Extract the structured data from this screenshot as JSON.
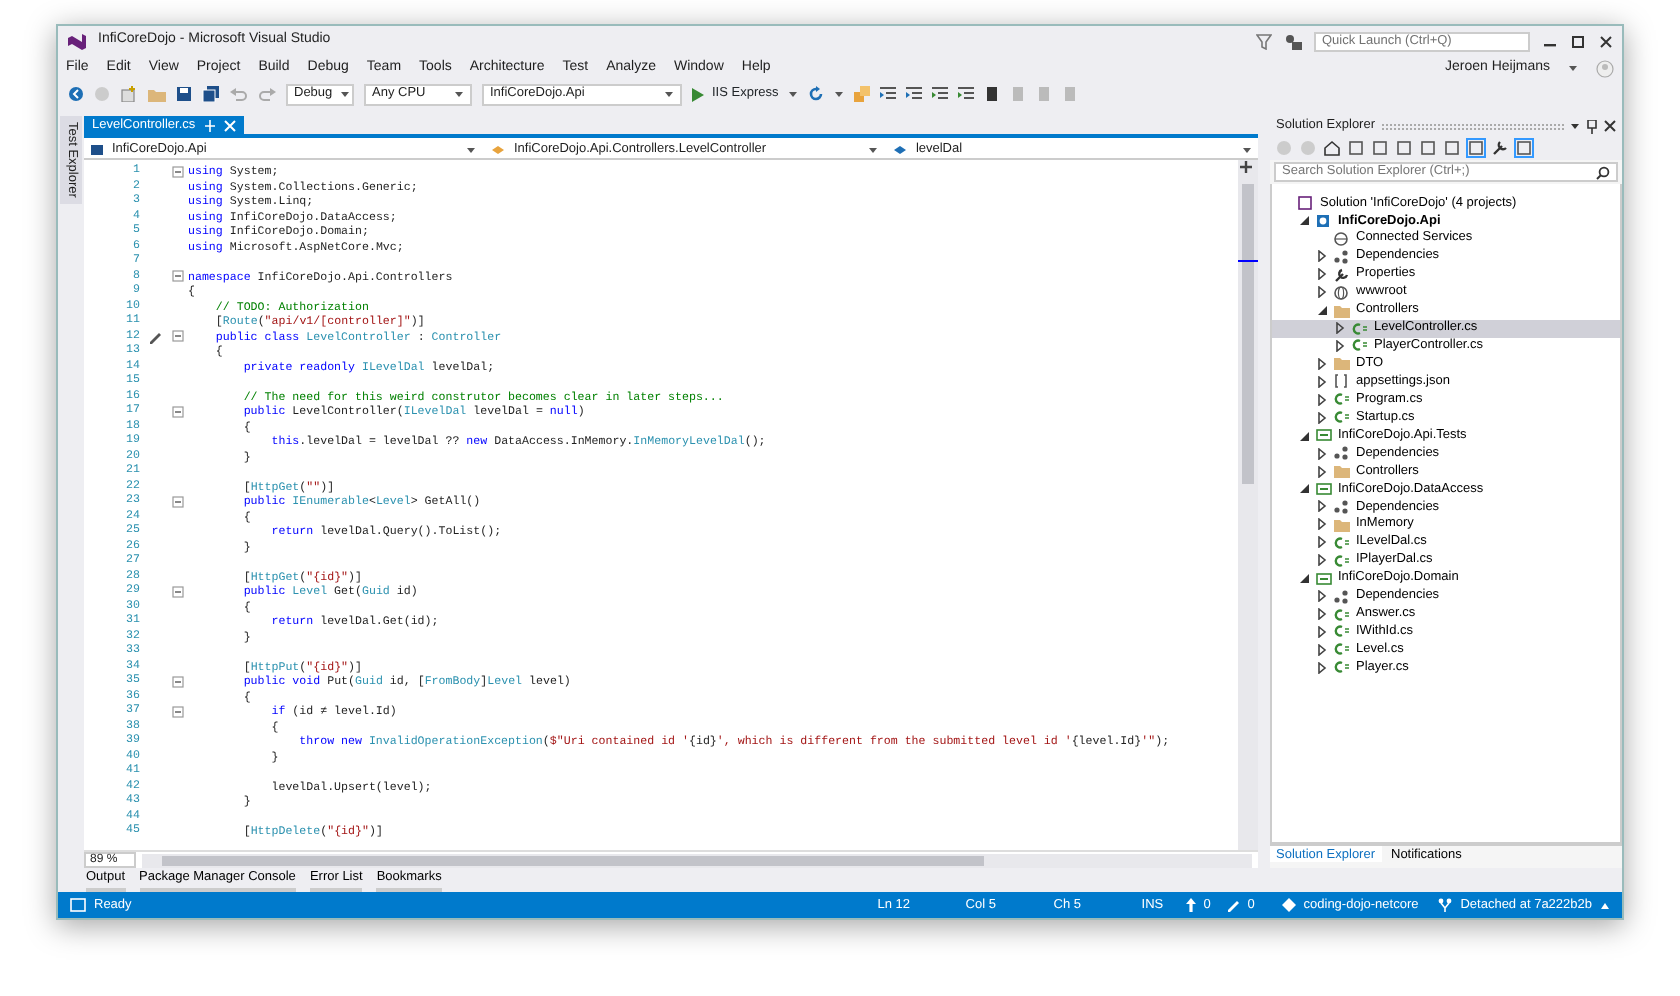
{
  "window": {
    "title": "InfiCoreDojo - Microsoft Visual Studio"
  },
  "title_bar": {
    "quick_launch": {
      "placeholder": "Quick Launch (Ctrl+Q)"
    },
    "user": "Jeroen Heijmans"
  },
  "menu": [
    "File",
    "Edit",
    "View",
    "Project",
    "Build",
    "Debug",
    "Team",
    "Tools",
    "Architecture",
    "Test",
    "Analyze",
    "Window",
    "Help"
  ],
  "toolbar": {
    "configuration": "Debug",
    "platform": "Any CPU",
    "startup_project": "InfiCoreDojo.Api",
    "run_button": "IIS Express"
  },
  "side_tabs": [
    "Test Explorer"
  ],
  "editor": {
    "tabs": [
      {
        "label": "LevelController.cs",
        "selected": true
      }
    ],
    "navigation": [
      "InfiCoreDojo.Api",
      "InfiCoreDojo.Api.Controllers.LevelController",
      "levelDal"
    ],
    "lines": [
      {
        "number": "1",
        "foldable": true,
        "edit_marker": false,
        "tokens": [
          {
            "kind": "keyword",
            "text": "using"
          },
          {
            "kind": "plain",
            "text": " System;"
          }
        ]
      },
      {
        "number": "2",
        "foldable": false,
        "edit_marker": false,
        "tokens": [
          {
            "kind": "keyword",
            "text": "using"
          },
          {
            "kind": "plain",
            "text": " System.Collections.Generic;"
          }
        ]
      },
      {
        "number": "3",
        "foldable": false,
        "edit_marker": false,
        "tokens": [
          {
            "kind": "keyword",
            "text": "using"
          },
          {
            "kind": "plain",
            "text": " System.Linq;"
          }
        ]
      },
      {
        "number": "4",
        "foldable": false,
        "edit_marker": false,
        "tokens": [
          {
            "kind": "keyword",
            "text": "using"
          },
          {
            "kind": "plain",
            "text": " InfiCoreDojo.DataAccess;"
          }
        ]
      },
      {
        "number": "5",
        "foldable": false,
        "edit_marker": false,
        "tokens": [
          {
            "kind": "keyword",
            "text": "using"
          },
          {
            "kind": "plain",
            "text": " InfiCoreDojo.Domain;"
          }
        ]
      },
      {
        "number": "6",
        "foldable": false,
        "edit_marker": false,
        "tokens": [
          {
            "kind": "keyword",
            "text": "using"
          },
          {
            "kind": "plain",
            "text": " Microsoft.AspNetCore.Mvc;"
          }
        ]
      },
      {
        "number": "7",
        "foldable": false,
        "edit_marker": false
      },
      {
        "number": "8",
        "foldable": true,
        "edit_marker": false,
        "tokens": [
          {
            "kind": "keyword",
            "text": "namespace"
          },
          {
            "kind": "plain",
            "text": " InfiCoreDojo.Api.Controllers"
          }
        ]
      },
      {
        "number": "9",
        "foldable": false,
        "edit_marker": false,
        "tokens": [
          {
            "kind": "plain",
            "text": "{"
          }
        ]
      },
      {
        "number": "10",
        "foldable": false,
        "edit_marker": false,
        "tokens": [
          {
            "kind": "comment",
            "text": "    // TODO: Authorization"
          }
        ]
      },
      {
        "number": "11",
        "foldable": false,
        "edit_marker": false,
        "tokens": [
          {
            "kind": "plain",
            "text": "    ["
          },
          {
            "kind": "type",
            "text": "Route"
          },
          {
            "kind": "plain",
            "text": "("
          },
          {
            "kind": "string",
            "text": "\"api/v1/[controller]\""
          },
          {
            "kind": "plain",
            "text": ")]"
          }
        ]
      },
      {
        "number": "12",
        "foldable": true,
        "edit_marker": true,
        "tokens": [
          {
            "kind": "keyword",
            "text": "    public class"
          },
          {
            "kind": "type",
            "text": " LevelController"
          },
          {
            "kind": "plain",
            "text": " : "
          },
          {
            "kind": "type",
            "text": "Controller"
          }
        ]
      },
      {
        "number": "13",
        "foldable": false,
        "edit_marker": false,
        "tokens": [
          {
            "kind": "plain",
            "text": "    {"
          }
        ]
      },
      {
        "number": "14",
        "foldable": false,
        "edit_marker": false,
        "tokens": [
          {
            "kind": "keyword",
            "text": "        private readonly"
          },
          {
            "kind": "type",
            "text": " ILevelDal"
          },
          {
            "kind": "plain",
            "text": " levelDal;"
          }
        ]
      },
      {
        "number": "15",
        "foldable": false,
        "edit_marker": false
      },
      {
        "number": "16",
        "foldable": false,
        "edit_marker": false,
        "tokens": [
          {
            "kind": "comment",
            "text": "        // The need for this weird construtor becomes clear in later steps..."
          }
        ]
      },
      {
        "number": "17",
        "foldable": true,
        "edit_marker": false,
        "tokens": [
          {
            "kind": "keyword",
            "text": "        public"
          },
          {
            "kind": "plain",
            "text": " LevelController("
          },
          {
            "kind": "type",
            "text": "ILevelDal"
          },
          {
            "kind": "plain",
            "text": " levelDal = "
          },
          {
            "kind": "keyword",
            "text": "null"
          },
          {
            "kind": "plain",
            "text": ")"
          }
        ]
      },
      {
        "number": "18",
        "foldable": false,
        "edit_marker": false,
        "tokens": [
          {
            "kind": "plain",
            "text": "        {"
          }
        ]
      },
      {
        "number": "19",
        "foldable": false,
        "edit_marker": false,
        "tokens": [
          {
            "kind": "keyword",
            "text": "            this"
          },
          {
            "kind": "plain",
            "text": ".levelDal = levelDal ?? "
          },
          {
            "kind": "keyword",
            "text": "new"
          },
          {
            "kind": "plain",
            "text": " DataAccess.InMemory."
          },
          {
            "kind": "type",
            "text": "InMemoryLevelDal"
          },
          {
            "kind": "plain",
            "text": "();"
          }
        ]
      },
      {
        "number": "20",
        "foldable": false,
        "edit_marker": false,
        "tokens": [
          {
            "kind": "plain",
            "text": "        }"
          }
        ]
      },
      {
        "number": "21",
        "foldable": false,
        "edit_marker": false
      },
      {
        "number": "22",
        "foldable": false,
        "edit_marker": false,
        "tokens": [
          {
            "kind": "plain",
            "text": "        ["
          },
          {
            "kind": "type",
            "text": "HttpGet"
          },
          {
            "kind": "plain",
            "text": "("
          },
          {
            "kind": "string",
            "text": "\"\""
          },
          {
            "kind": "plain",
            "text": ")]"
          }
        ]
      },
      {
        "number": "23",
        "foldable": true,
        "edit_marker": false,
        "tokens": [
          {
            "kind": "keyword",
            "text": "        public"
          },
          {
            "kind": "type",
            "text": " IEnumerable"
          },
          {
            "kind": "plain",
            "text": "<"
          },
          {
            "kind": "type",
            "text": "Level"
          },
          {
            "kind": "plain",
            "text": "> GetAll()"
          }
        ]
      },
      {
        "number": "24",
        "foldable": false,
        "edit_marker": false,
        "tokens": [
          {
            "kind": "plain",
            "text": "        {"
          }
        ]
      },
      {
        "number": "25",
        "foldable": false,
        "edit_marker": false,
        "tokens": [
          {
            "kind": "keyword",
            "text": "            return"
          },
          {
            "kind": "plain",
            "text": " levelDal.Query().ToList();"
          }
        ]
      },
      {
        "number": "26",
        "foldable": false,
        "edit_marker": false,
        "tokens": [
          {
            "kind": "plain",
            "text": "        }"
          }
        ]
      },
      {
        "number": "27",
        "foldable": false,
        "edit_marker": false
      },
      {
        "number": "28",
        "foldable": false,
        "edit_marker": false,
        "tokens": [
          {
            "kind": "plain",
            "text": "        ["
          },
          {
            "kind": "type",
            "text": "HttpGet"
          },
          {
            "kind": "plain",
            "text": "("
          },
          {
            "kind": "string",
            "text": "\"{id}\""
          },
          {
            "kind": "plain",
            "text": ")]"
          }
        ]
      },
      {
        "number": "29",
        "foldable": true,
        "edit_marker": false,
        "tokens": [
          {
            "kind": "keyword",
            "text": "        public"
          },
          {
            "kind": "type",
            "text": " Level"
          },
          {
            "kind": "plain",
            "text": " Get("
          },
          {
            "kind": "type",
            "text": "Guid"
          },
          {
            "kind": "plain",
            "text": " id)"
          }
        ]
      },
      {
        "number": "30",
        "foldable": false,
        "edit_marker": false,
        "tokens": [
          {
            "kind": "plain",
            "text": "        {"
          }
        ]
      },
      {
        "number": "31",
        "foldable": false,
        "edit_marker": false,
        "tokens": [
          {
            "kind": "keyword",
            "text": "            return"
          },
          {
            "kind": "plain",
            "text": " levelDal.Get(id);"
          }
        ]
      },
      {
        "number": "32",
        "foldable": false,
        "edit_marker": false,
        "tokens": [
          {
            "kind": "plain",
            "text": "        }"
          }
        ]
      },
      {
        "number": "33",
        "foldable": false,
        "edit_marker": false
      },
      {
        "number": "34",
        "foldable": false,
        "edit_marker": false,
        "tokens": [
          {
            "kind": "plain",
            "text": "        ["
          },
          {
            "kind": "type",
            "text": "HttpPut"
          },
          {
            "kind": "plain",
            "text": "("
          },
          {
            "kind": "string",
            "text": "\"{id}\""
          },
          {
            "kind": "plain",
            "text": ")]"
          }
        ]
      },
      {
        "number": "35",
        "foldable": true,
        "edit_marker": false,
        "tokens": [
          {
            "kind": "keyword",
            "text": "        public void"
          },
          {
            "kind": "plain",
            "text": " Put("
          },
          {
            "kind": "type",
            "text": "Guid"
          },
          {
            "kind": "plain",
            "text": " id, ["
          },
          {
            "kind": "type",
            "text": "FromBody"
          },
          {
            "kind": "plain",
            "text": "]"
          },
          {
            "kind": "type",
            "text": "Level"
          },
          {
            "kind": "plain",
            "text": " level)"
          }
        ]
      },
      {
        "number": "36",
        "foldable": false,
        "edit_marker": false,
        "tokens": [
          {
            "kind": "plain",
            "text": "        {"
          }
        ]
      },
      {
        "number": "37",
        "foldable": true,
        "edit_marker": false,
        "tokens": [
          {
            "kind": "keyword",
            "text": "            if"
          },
          {
            "kind": "plain",
            "text": " (id ≠ level.Id)"
          }
        ]
      },
      {
        "number": "38",
        "foldable": false,
        "edit_marker": false,
        "tokens": [
          {
            "kind": "plain",
            "text": "            {"
          }
        ]
      },
      {
        "number": "39",
        "foldable": false,
        "edit_marker": false,
        "tokens": [
          {
            "kind": "keyword",
            "text": "                throw new"
          },
          {
            "kind": "type",
            "text": " InvalidOperationException"
          },
          {
            "kind": "plain",
            "text": "("
          },
          {
            "kind": "string",
            "text": "$\"Uri contained id '"
          },
          {
            "kind": "plain",
            "text": "{id}"
          },
          {
            "kind": "string",
            "text": "', which is different from the submitted level id '"
          },
          {
            "kind": "plain",
            "text": "{level.Id}"
          },
          {
            "kind": "string",
            "text": "'\""
          },
          {
            "kind": "plain",
            "text": ");"
          }
        ]
      },
      {
        "number": "40",
        "foldable": false,
        "edit_marker": false,
        "tokens": [
          {
            "kind": "plain",
            "text": "            }"
          }
        ]
      },
      {
        "number": "41",
        "foldable": false,
        "edit_marker": false
      },
      {
        "number": "42",
        "foldable": false,
        "edit_marker": false,
        "tokens": [
          {
            "kind": "plain",
            "text": "            levelDal.Upsert(level);"
          }
        ]
      },
      {
        "number": "43",
        "foldable": false,
        "edit_marker": false,
        "tokens": [
          {
            "kind": "plain",
            "text": "        }"
          }
        ]
      },
      {
        "number": "44",
        "foldable": false,
        "edit_marker": false
      },
      {
        "number": "45",
        "foldable": false,
        "edit_marker": false,
        "tokens": [
          {
            "kind": "plain",
            "text": "        ["
          },
          {
            "kind": "type",
            "text": "HttpDelete"
          },
          {
            "kind": "plain",
            "text": "("
          },
          {
            "kind": "string",
            "text": "\"{id}\""
          },
          {
            "kind": "plain",
            "text": ")]"
          }
        ]
      }
    ],
    "zoom": "89 %"
  },
  "bottom_tabs": [
    "Output",
    "Package Manager Console",
    "Error List",
    "Bookmarks"
  ],
  "solution_explorer": {
    "title": "Solution Explorer",
    "search": {
      "placeholder": "Search Solution Explorer (Ctrl+;)"
    },
    "tree": [
      {
        "label": "Solution 'InfiCoreDojo' (4 projects)",
        "kind": "solution",
        "selected": false,
        "children": [
          {
            "label": "InfiCoreDojo.Api",
            "kind": "web-project",
            "expanded": true,
            "selected": false,
            "children": [
              {
                "label": "Connected Services",
                "kind": "connected",
                "selected": false
              },
              {
                "label": "Dependencies",
                "kind": "dependencies",
                "expanded": false,
                "selected": false
              },
              {
                "label": "Properties",
                "kind": "properties",
                "expanded": false,
                "selected": false
              },
              {
                "label": "wwwroot",
                "kind": "globe",
                "expanded": false,
                "selected": false
              },
              {
                "label": "Controllers",
                "kind": "folder",
                "expanded": true,
                "selected": false,
                "children": [
                  {
                    "label": "LevelController.cs",
                    "kind": "cs",
                    "expanded": false,
                    "selected": true
                  },
                  {
                    "label": "PlayerController.cs",
                    "kind": "cs",
                    "expanded": false,
                    "selected": false
                  }
                ]
              },
              {
                "label": "DTO",
                "kind": "folder",
                "expanded": false,
                "selected": false
              },
              {
                "label": "appsettings.json",
                "kind": "json",
                "expanded": false,
                "selected": false
              },
              {
                "label": "Program.cs",
                "kind": "cs",
                "expanded": false,
                "selected": false
              },
              {
                "label": "Startup.cs",
                "kind": "cs",
                "expanded": false,
                "selected": false
              }
            ]
          },
          {
            "label": "InfiCoreDojo.Api.Tests",
            "kind": "project",
            "expanded": true,
            "selected": false,
            "children": [
              {
                "label": "Dependencies",
                "kind": "dependencies",
                "expanded": false,
                "selected": false
              },
              {
                "label": "Controllers",
                "kind": "folder",
                "expanded": false,
                "selected": false
              }
            ]
          },
          {
            "label": "InfiCoreDojo.DataAccess",
            "kind": "project",
            "expanded": true,
            "selected": false,
            "children": [
              {
                "label": "Dependencies",
                "kind": "dependencies",
                "expanded": false,
                "selected": false
              },
              {
                "label": "InMemory",
                "kind": "folder",
                "expanded": false,
                "selected": false
              },
              {
                "label": "ILevelDal.cs",
                "kind": "cs",
                "expanded": false,
                "selected": false
              },
              {
                "label": "IPlayerDal.cs",
                "kind": "cs",
                "expanded": false,
                "selected": false
              }
            ]
          },
          {
            "label": "InfiCoreDojo.Domain",
            "kind": "project",
            "expanded": true,
            "selected": false,
            "children": [
              {
                "label": "Dependencies",
                "kind": "dependencies",
                "expanded": false,
                "selected": false
              },
              {
                "label": "Answer.cs",
                "kind": "cs",
                "expanded": false,
                "selected": false
              },
              {
                "label": "IWithId.cs",
                "kind": "cs",
                "expanded": false,
                "selected": false
              },
              {
                "label": "Level.cs",
                "kind": "cs",
                "expanded": false,
                "selected": false
              },
              {
                "label": "Player.cs",
                "kind": "cs",
                "expanded": false,
                "selected": false
              }
            ]
          }
        ]
      }
    ],
    "tabs": [
      {
        "label": "Solution Explorer",
        "selected": true
      },
      {
        "label": "Notifications",
        "selected": false
      }
    ]
  },
  "status_bar": {
    "message": "Ready",
    "line": "Ln 12",
    "column": "Col 5",
    "char": "Ch 5",
    "mode": "INS",
    "pushes": "0",
    "changes": "0",
    "repository": "coding-dojo-netcore",
    "branch": "Detached at 7a222b2b"
  }
}
